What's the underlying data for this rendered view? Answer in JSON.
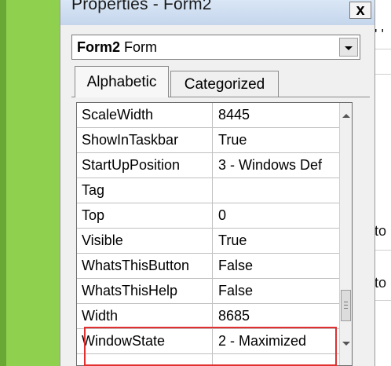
{
  "window": {
    "title": "Properties - Form2",
    "close_glyph": "x"
  },
  "object_combo": {
    "name": "Form2",
    "type": "Form"
  },
  "tabs": [
    {
      "label": "Alphabetic",
      "active": true
    },
    {
      "label": "Categorized",
      "active": false
    }
  ],
  "properties": [
    {
      "name": "ScaleWidth",
      "value": "8445"
    },
    {
      "name": "ShowInTaskbar",
      "value": "True"
    },
    {
      "name": "StartUpPosition",
      "value": "3 - Windows Def"
    },
    {
      "name": "Tag",
      "value": ""
    },
    {
      "name": "Top",
      "value": "0"
    },
    {
      "name": "Visible",
      "value": "True"
    },
    {
      "name": "WhatsThisButton",
      "value": "False"
    },
    {
      "name": "WhatsThisHelp",
      "value": "False"
    },
    {
      "name": "Width",
      "value": "8685"
    },
    {
      "name": "WindowState",
      "value": "2 - Maximized"
    }
  ],
  "background_fragments": {
    "top": "' '",
    "mid1": "to",
    "mid2": "to"
  },
  "colors": {
    "highlight": "#e03030",
    "page_background": "#8fd14f"
  }
}
